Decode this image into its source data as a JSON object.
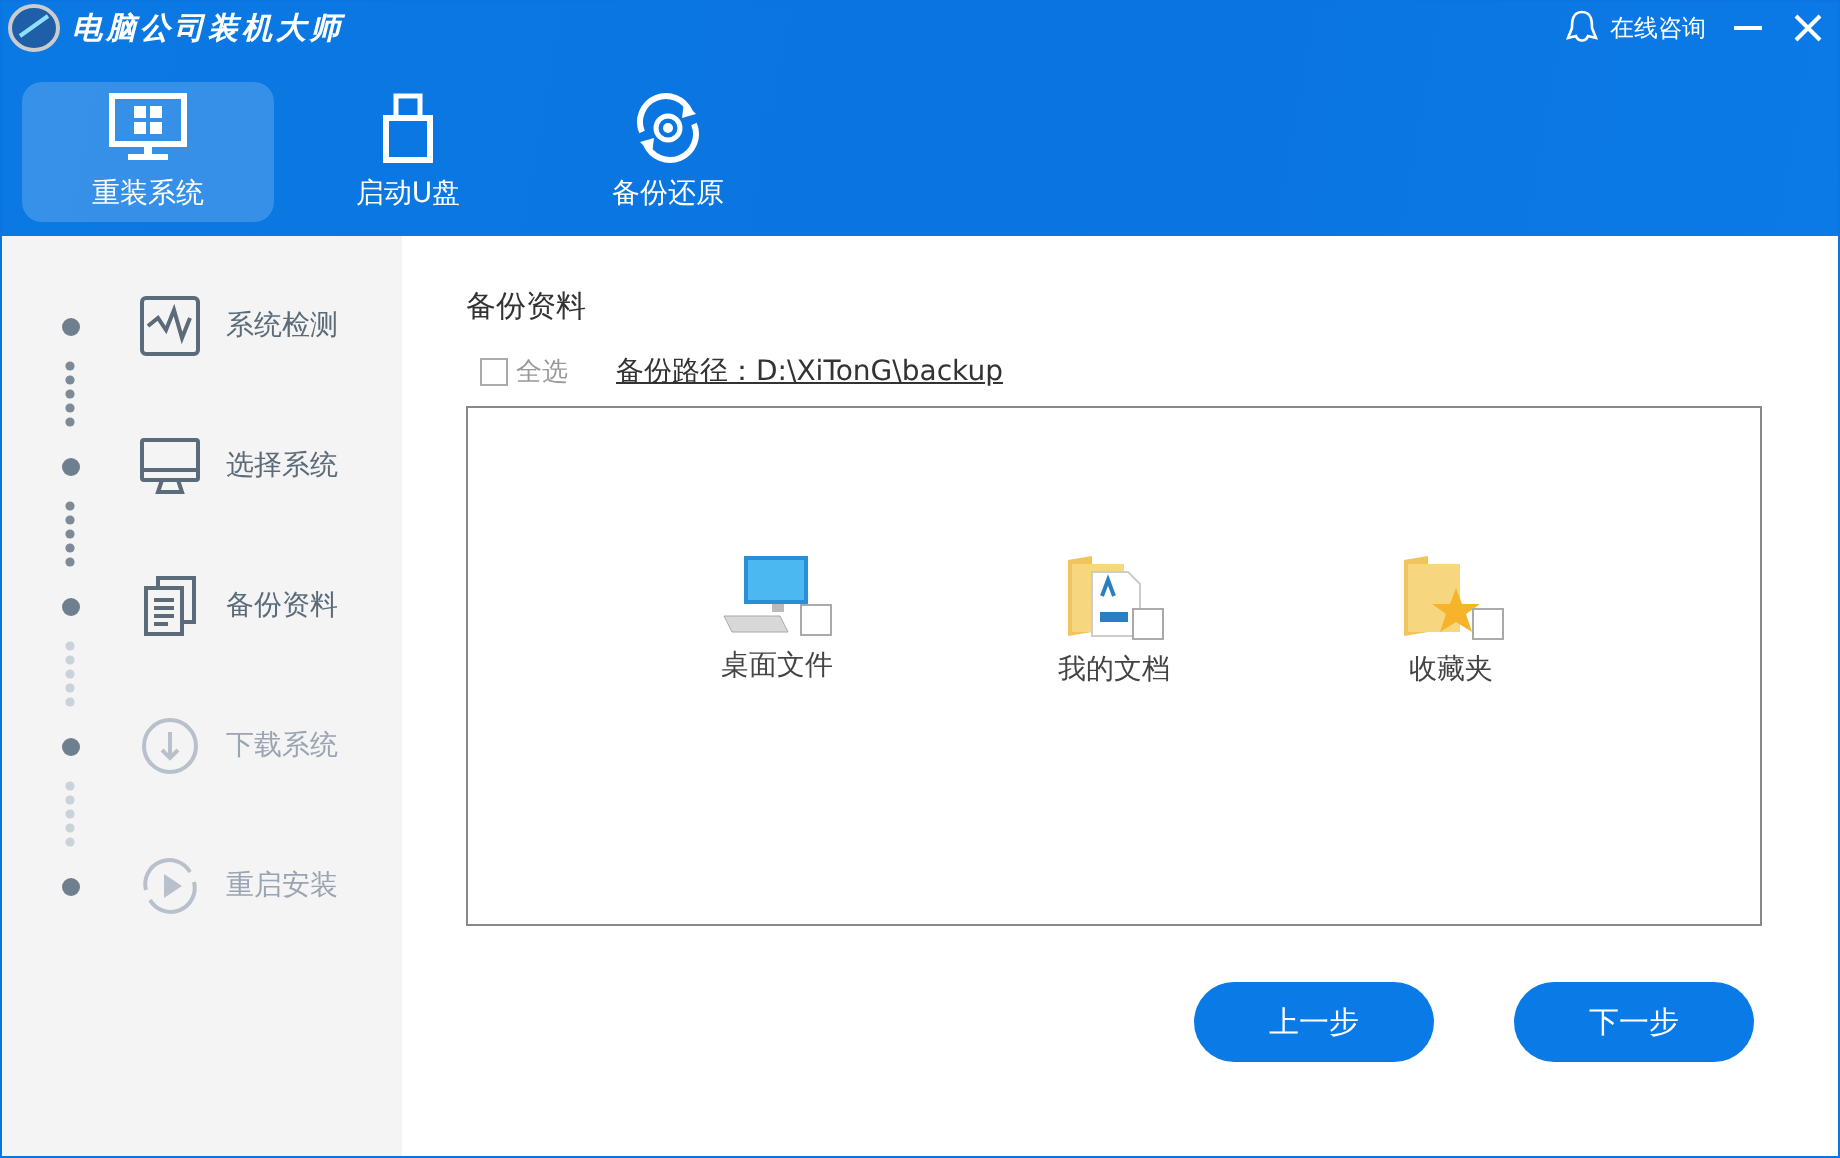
{
  "window": {
    "title": "电脑公司装机大师",
    "consult": "在线咨询"
  },
  "nav": [
    {
      "label": "重装系统",
      "kind": "monitor",
      "selected": true
    },
    {
      "label": "启动U盘",
      "kind": "usb",
      "selected": false
    },
    {
      "label": "备份还原",
      "kind": "restore",
      "selected": false
    }
  ],
  "steps": [
    {
      "label": "系统检测",
      "kind": "pulse",
      "done": true
    },
    {
      "label": "选择系统",
      "kind": "screen",
      "done": true
    },
    {
      "label": "备份资料",
      "kind": "docs",
      "done": true
    },
    {
      "label": "下载系统",
      "kind": "download",
      "done": false
    },
    {
      "label": "重启安装",
      "kind": "replay",
      "done": false
    }
  ],
  "section_title": "备份资料",
  "select_all": {
    "label": "全选",
    "checked": false
  },
  "backup_path": "备份路径：D:\\XiTonG\\backup",
  "items": [
    {
      "label": "桌面文件",
      "kind": "computer",
      "checked": false
    },
    {
      "label": "我的文档",
      "kind": "documents",
      "checked": false
    },
    {
      "label": "收藏夹",
      "kind": "favorites",
      "checked": false
    }
  ],
  "buttons": [
    {
      "label": "上一步"
    },
    {
      "label": "下一步"
    }
  ]
}
